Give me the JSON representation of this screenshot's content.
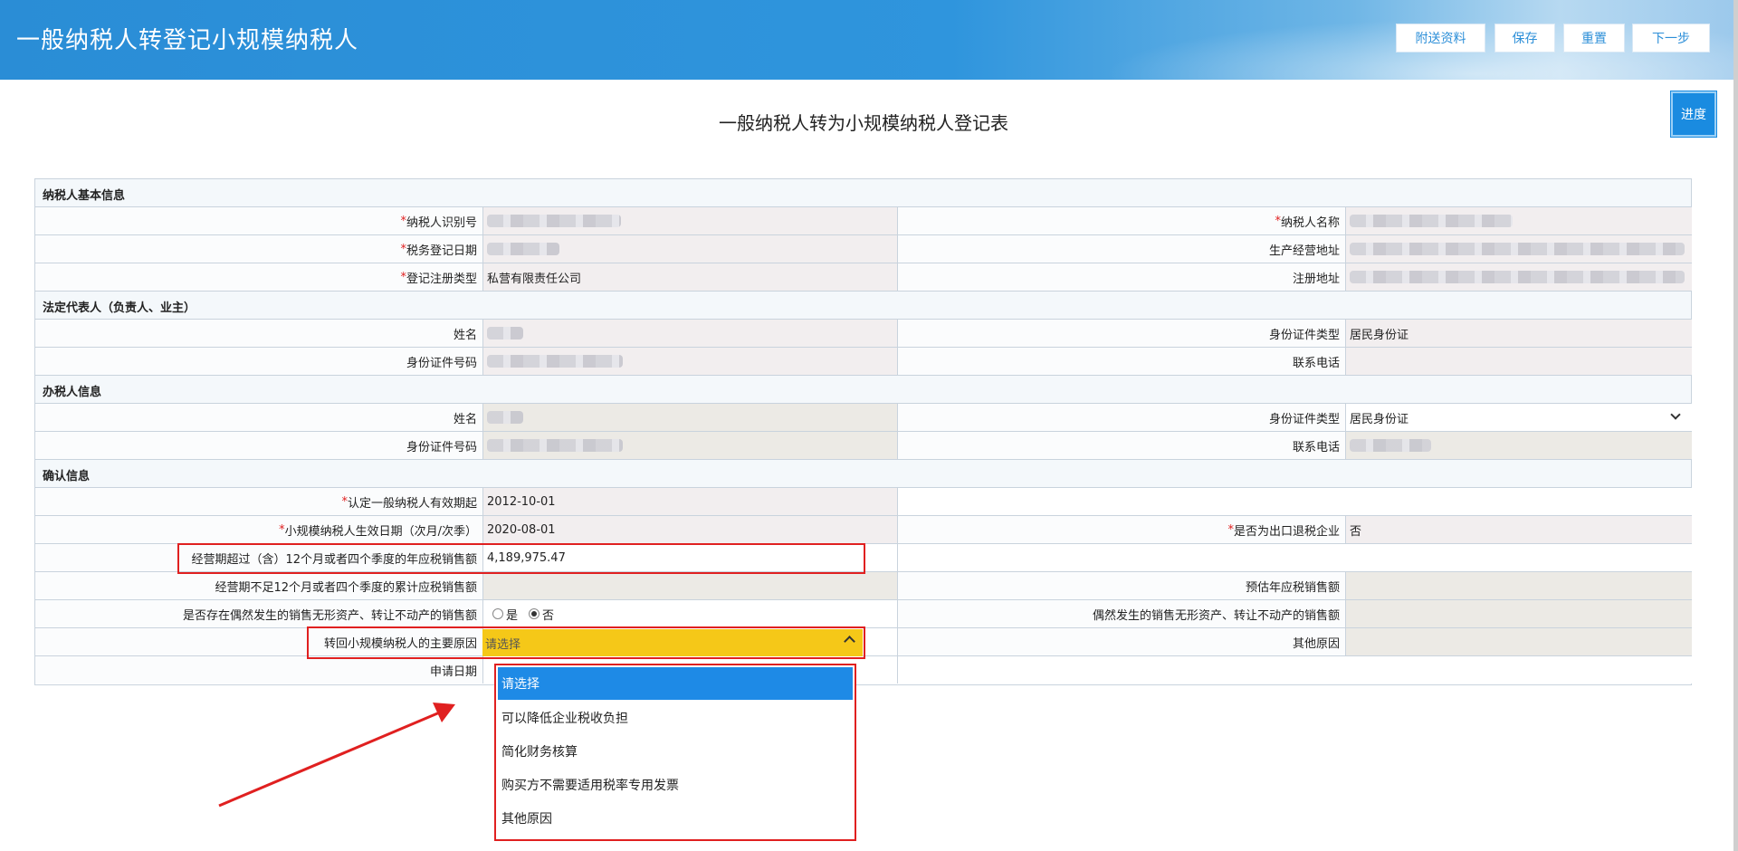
{
  "header": {
    "title": "一般纳税人转登记小规模纳税人",
    "buttons": [
      "附送资料",
      "保存",
      "重置",
      "下一步"
    ]
  },
  "progress_label": "进度",
  "page_title": "一般纳税人转为小规模纳税人登记表",
  "sections": {
    "basic": "纳税人基本信息",
    "legal": "法定代表人（负责人、业主）",
    "agent": "办税人信息",
    "confirm": "确认信息"
  },
  "basic": {
    "taxpayer_id_label": "纳税人识别号",
    "taxpayer_name_label": "纳税人名称",
    "reg_date_label": "税务登记日期",
    "business_addr_label": "生产经营地址",
    "reg_type_label": "登记注册类型",
    "reg_type_value": "私营有限责任公司",
    "reg_addr_label": "注册地址"
  },
  "legal": {
    "name_label": "姓名",
    "id_type_label": "身份证件类型",
    "id_type_value": "居民身份证",
    "id_no_label": "身份证件号码",
    "phone_label": "联系电话"
  },
  "agent": {
    "name_label": "姓名",
    "id_type_label": "身份证件类型",
    "id_type_value": "居民身份证",
    "id_no_label": "身份证件号码",
    "phone_label": "联系电话"
  },
  "confirm": {
    "general_start_label": "认定一般纳税人有效期起",
    "general_start_value": "2012-10-01",
    "small_effective_label": "小规模纳税人生效日期（次月/次季）",
    "small_effective_value": "2020-08-01",
    "export_label": "是否为出口退税企业",
    "export_value": "否",
    "over12_label": "经营期超过（含）12个月或者四个季度的年应税销售额",
    "over12_value": "4,189,975.47",
    "under12_label": "经营期不足12个月或者四个季度的累计应税销售额",
    "estimate_label": "预估年应税销售额",
    "occasional_q_label": "是否存在偶然发生的销售无形资产、转让不动产的销售额",
    "occasional_yes": "是",
    "occasional_no": "否",
    "occasional_amount_label": "偶然发生的销售无形资产、转让不动产的销售额",
    "reason_label": "转回小规模纳税人的主要原因",
    "reason_value": "请选择",
    "other_reason_label": "其他原因",
    "apply_date_label": "申请日期"
  },
  "dropdown_options": [
    "请选择",
    "可以降低企业税收负担",
    "简化财务核算",
    "购买方不需要适用税率专用发票",
    "其他原因"
  ]
}
